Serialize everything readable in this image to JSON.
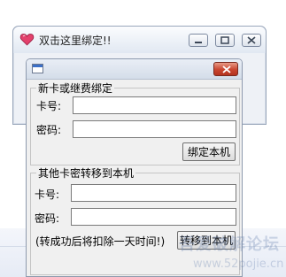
{
  "back_window": {
    "title": "双击这里绑定!!"
  },
  "dialog": {
    "bind_group": {
      "legend": "新卡或继费绑定",
      "card_label": "卡号:",
      "card_value": "",
      "password_label": "密码:",
      "password_value": "",
      "bind_button": "绑定本机"
    },
    "transfer_group": {
      "legend": "其他卡密转移到本机",
      "card_label": "卡号:",
      "card_value": "",
      "password_label": "密码:",
      "password_value": "",
      "note": "(转成功后将扣除一天时间!)",
      "transfer_button": "转移到本机"
    }
  },
  "watermark": {
    "text": "吾爱破解论坛",
    "url": "www.52pojie.cn"
  },
  "icons": {
    "title_icon": "heart-icon",
    "dialog_icon": "window-icon"
  },
  "colors": {
    "heart": "#e3416c",
    "close_button": "#c9452f"
  }
}
